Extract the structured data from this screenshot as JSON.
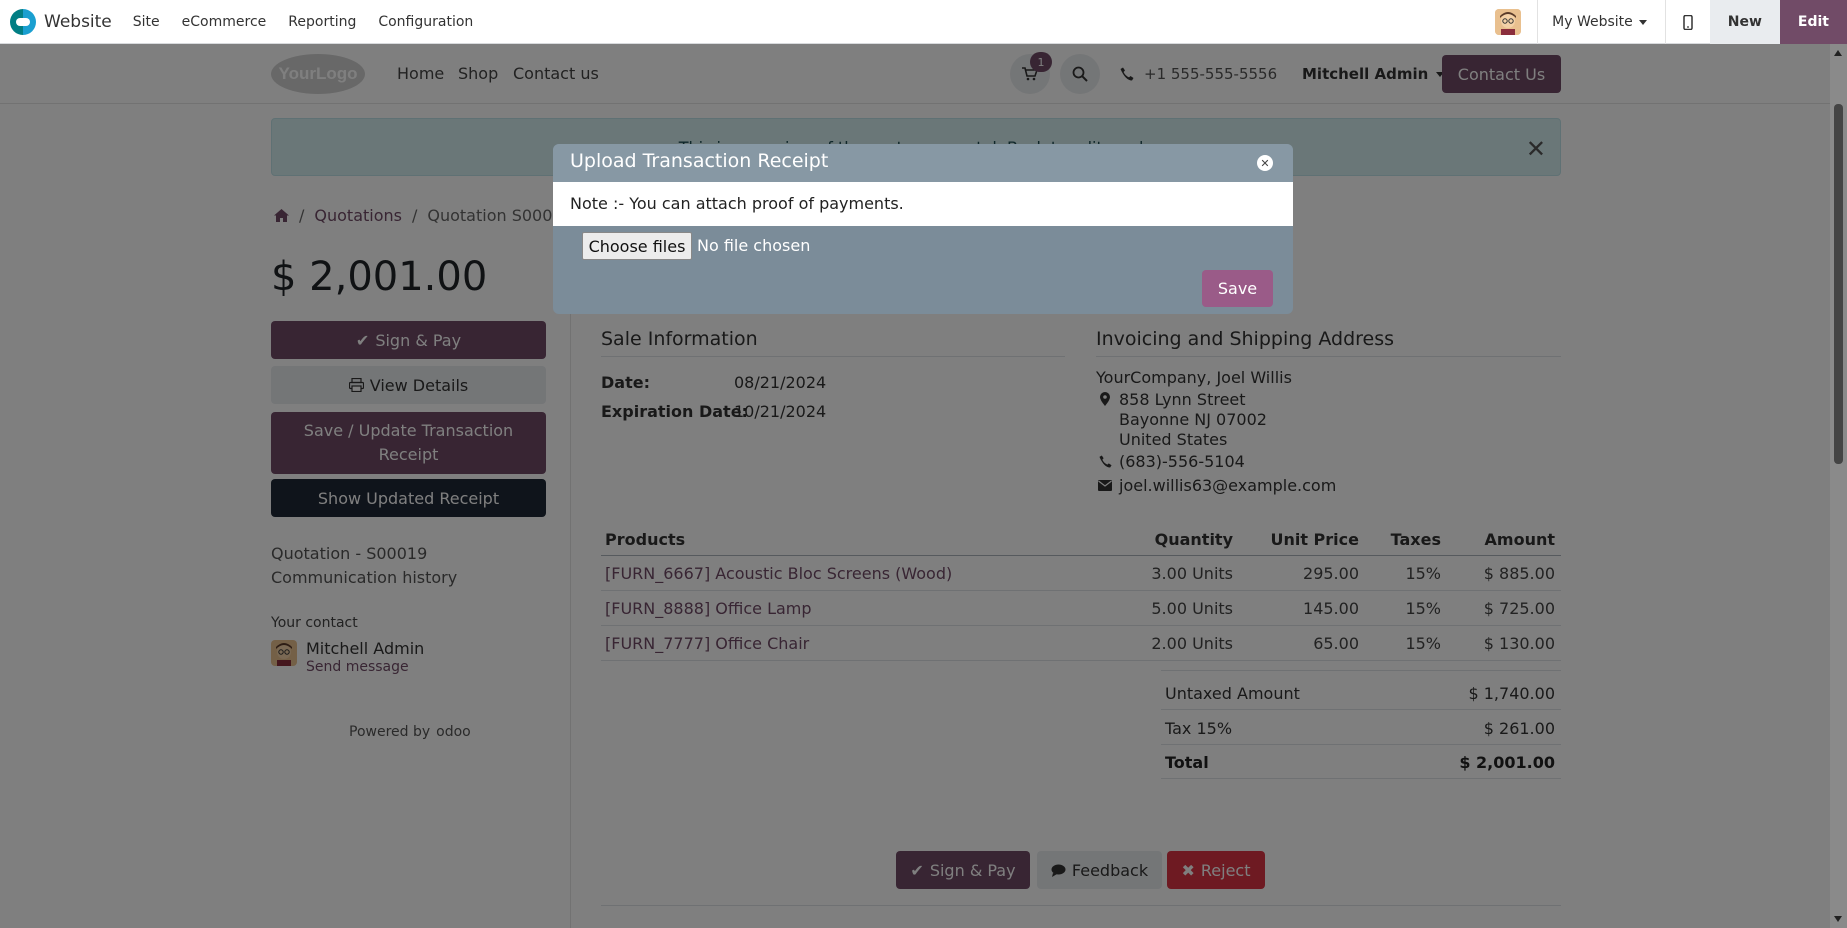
{
  "topbar": {
    "app_name": "Website",
    "menus": [
      "Site",
      "eCommerce",
      "Reporting",
      "Configuration"
    ],
    "my_website": "My Website",
    "new_label": "New",
    "edit_label": "Edit"
  },
  "header": {
    "logo_text": "YourLogo",
    "nav": [
      "Home",
      "Shop",
      "Contact us"
    ],
    "cart_count": "1",
    "phone": "+1 555-555-5556",
    "user": "Mitchell Admin",
    "contact_btn": "Contact Us"
  },
  "alert": {
    "text": "This is a preview of the customer portal. Back to edit mode"
  },
  "breadcrumb": [
    "Quotations",
    "Quotation S00019"
  ],
  "sidebar": {
    "price": "$ 2,001.00",
    "sign_pay": "Sign & Pay",
    "view_details": "View Details",
    "save_update": "Save / Update Transaction Receipt",
    "show_receipt": "Show Updated Receipt",
    "quotation_ref": "Quotation - S00019",
    "comm_history": "Communication history",
    "your_contact": "Your contact",
    "contact_name": "Mitchell Admin",
    "send_message": "Send message",
    "powered_by": "Powered by",
    "odoo": "odoo"
  },
  "sale_info": {
    "title": "Sale Information",
    "date_label": "Date:",
    "date_value": "08/21/2024",
    "exp_label": "Expiration Date:",
    "exp_value": "10/21/2024"
  },
  "address": {
    "title": "Invoicing and Shipping Address",
    "name": "YourCompany, Joel Willis",
    "street": "858 Lynn Street",
    "city": "Bayonne NJ 07002",
    "country": "United States",
    "phone": "(683)-556-5104",
    "email": "joel.willis63@example.com"
  },
  "products": {
    "headers": [
      "Products",
      "Quantity",
      "Unit Price",
      "Taxes",
      "Amount"
    ],
    "rows": [
      {
        "name": "[FURN_6667] Acoustic Bloc Screens (Wood)",
        "qty": "3.00 Units",
        "price": "295.00",
        "tax": "15%",
        "amount": "$ 885.00"
      },
      {
        "name": "[FURN_8888] Office Lamp",
        "qty": "5.00 Units",
        "price": "145.00",
        "tax": "15%",
        "amount": "$ 725.00"
      },
      {
        "name": "[FURN_7777] Office Chair",
        "qty": "2.00 Units",
        "price": "65.00",
        "tax": "15%",
        "amount": "$ 130.00"
      }
    ]
  },
  "totals": {
    "untaxed_label": "Untaxed Amount",
    "untaxed_value": "$ 1,740.00",
    "tax_label": "Tax 15%",
    "tax_value": "$ 261.00",
    "total_label": "Total",
    "total_value": "$ 2,001.00"
  },
  "actions": {
    "sign_pay": "Sign & Pay",
    "feedback": "Feedback",
    "reject": "Reject"
  },
  "modal": {
    "title": "Upload Transaction Receipt",
    "note": "Note :- You can attach proof of payments.",
    "choose_files": "Choose files",
    "no_file": "No file chosen",
    "save": "Save"
  },
  "colors": {
    "brand": "#714b67",
    "dark_button": "#1f2937",
    "reject": "#dc3545"
  }
}
